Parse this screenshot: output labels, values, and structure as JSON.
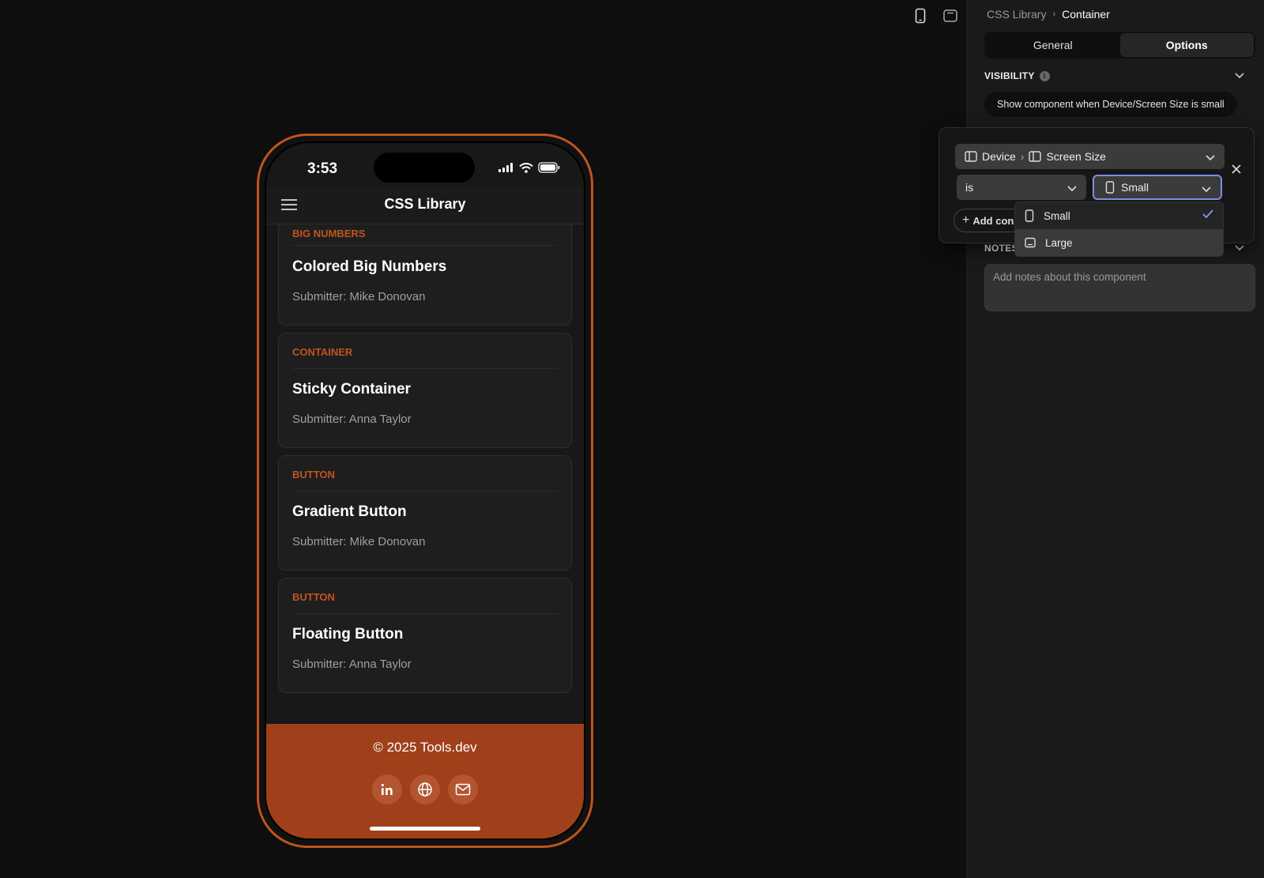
{
  "canvas": {
    "toolbar": {
      "mobile_icon": "phone-icon",
      "desktop_icon": "tablet-icon"
    }
  },
  "phone": {
    "status": {
      "time": "3:53"
    },
    "appbar": {
      "title": "CSS Library"
    },
    "cards": [
      {
        "category": "BIG NUMBERS",
        "title": "Colored Big Numbers",
        "submitter": "Submitter: Mike Donovan"
      },
      {
        "category": "CONTAINER",
        "title": "Sticky Container",
        "submitter": "Submitter: Anna Taylor"
      },
      {
        "category": "BUTTON",
        "title": "Gradient Button",
        "submitter": "Submitter: Mike Donovan"
      },
      {
        "category": "BUTTON",
        "title": "Floating Button",
        "submitter": "Submitter: Anna Taylor"
      }
    ],
    "footer": {
      "copyright": "© 2025 Tools.dev",
      "socials": [
        "linkedin-icon",
        "globe-icon",
        "mail-icon"
      ]
    },
    "accent": "#a0401a"
  },
  "panel": {
    "breadcrumb": {
      "parent": "CSS Library",
      "current": "Container"
    },
    "tabs": [
      "General",
      "Options"
    ],
    "active_tab": "Options",
    "visibility": {
      "label": "VISIBILITY",
      "rule": "Show component when Device/Screen Size is small"
    },
    "notes": {
      "label": "NOTES",
      "placeholder": "Add notes about this component"
    }
  },
  "popover": {
    "source": {
      "device": "Device",
      "field": "Screen Size"
    },
    "operator": "is",
    "value": "Small",
    "add_condition": "Add con",
    "options": [
      {
        "label": "Small",
        "icon": "phone-icon",
        "selected": true
      },
      {
        "label": "Large",
        "icon": "tablet-icon",
        "selected": false
      }
    ],
    "focus_color": "#7f8ce8"
  }
}
